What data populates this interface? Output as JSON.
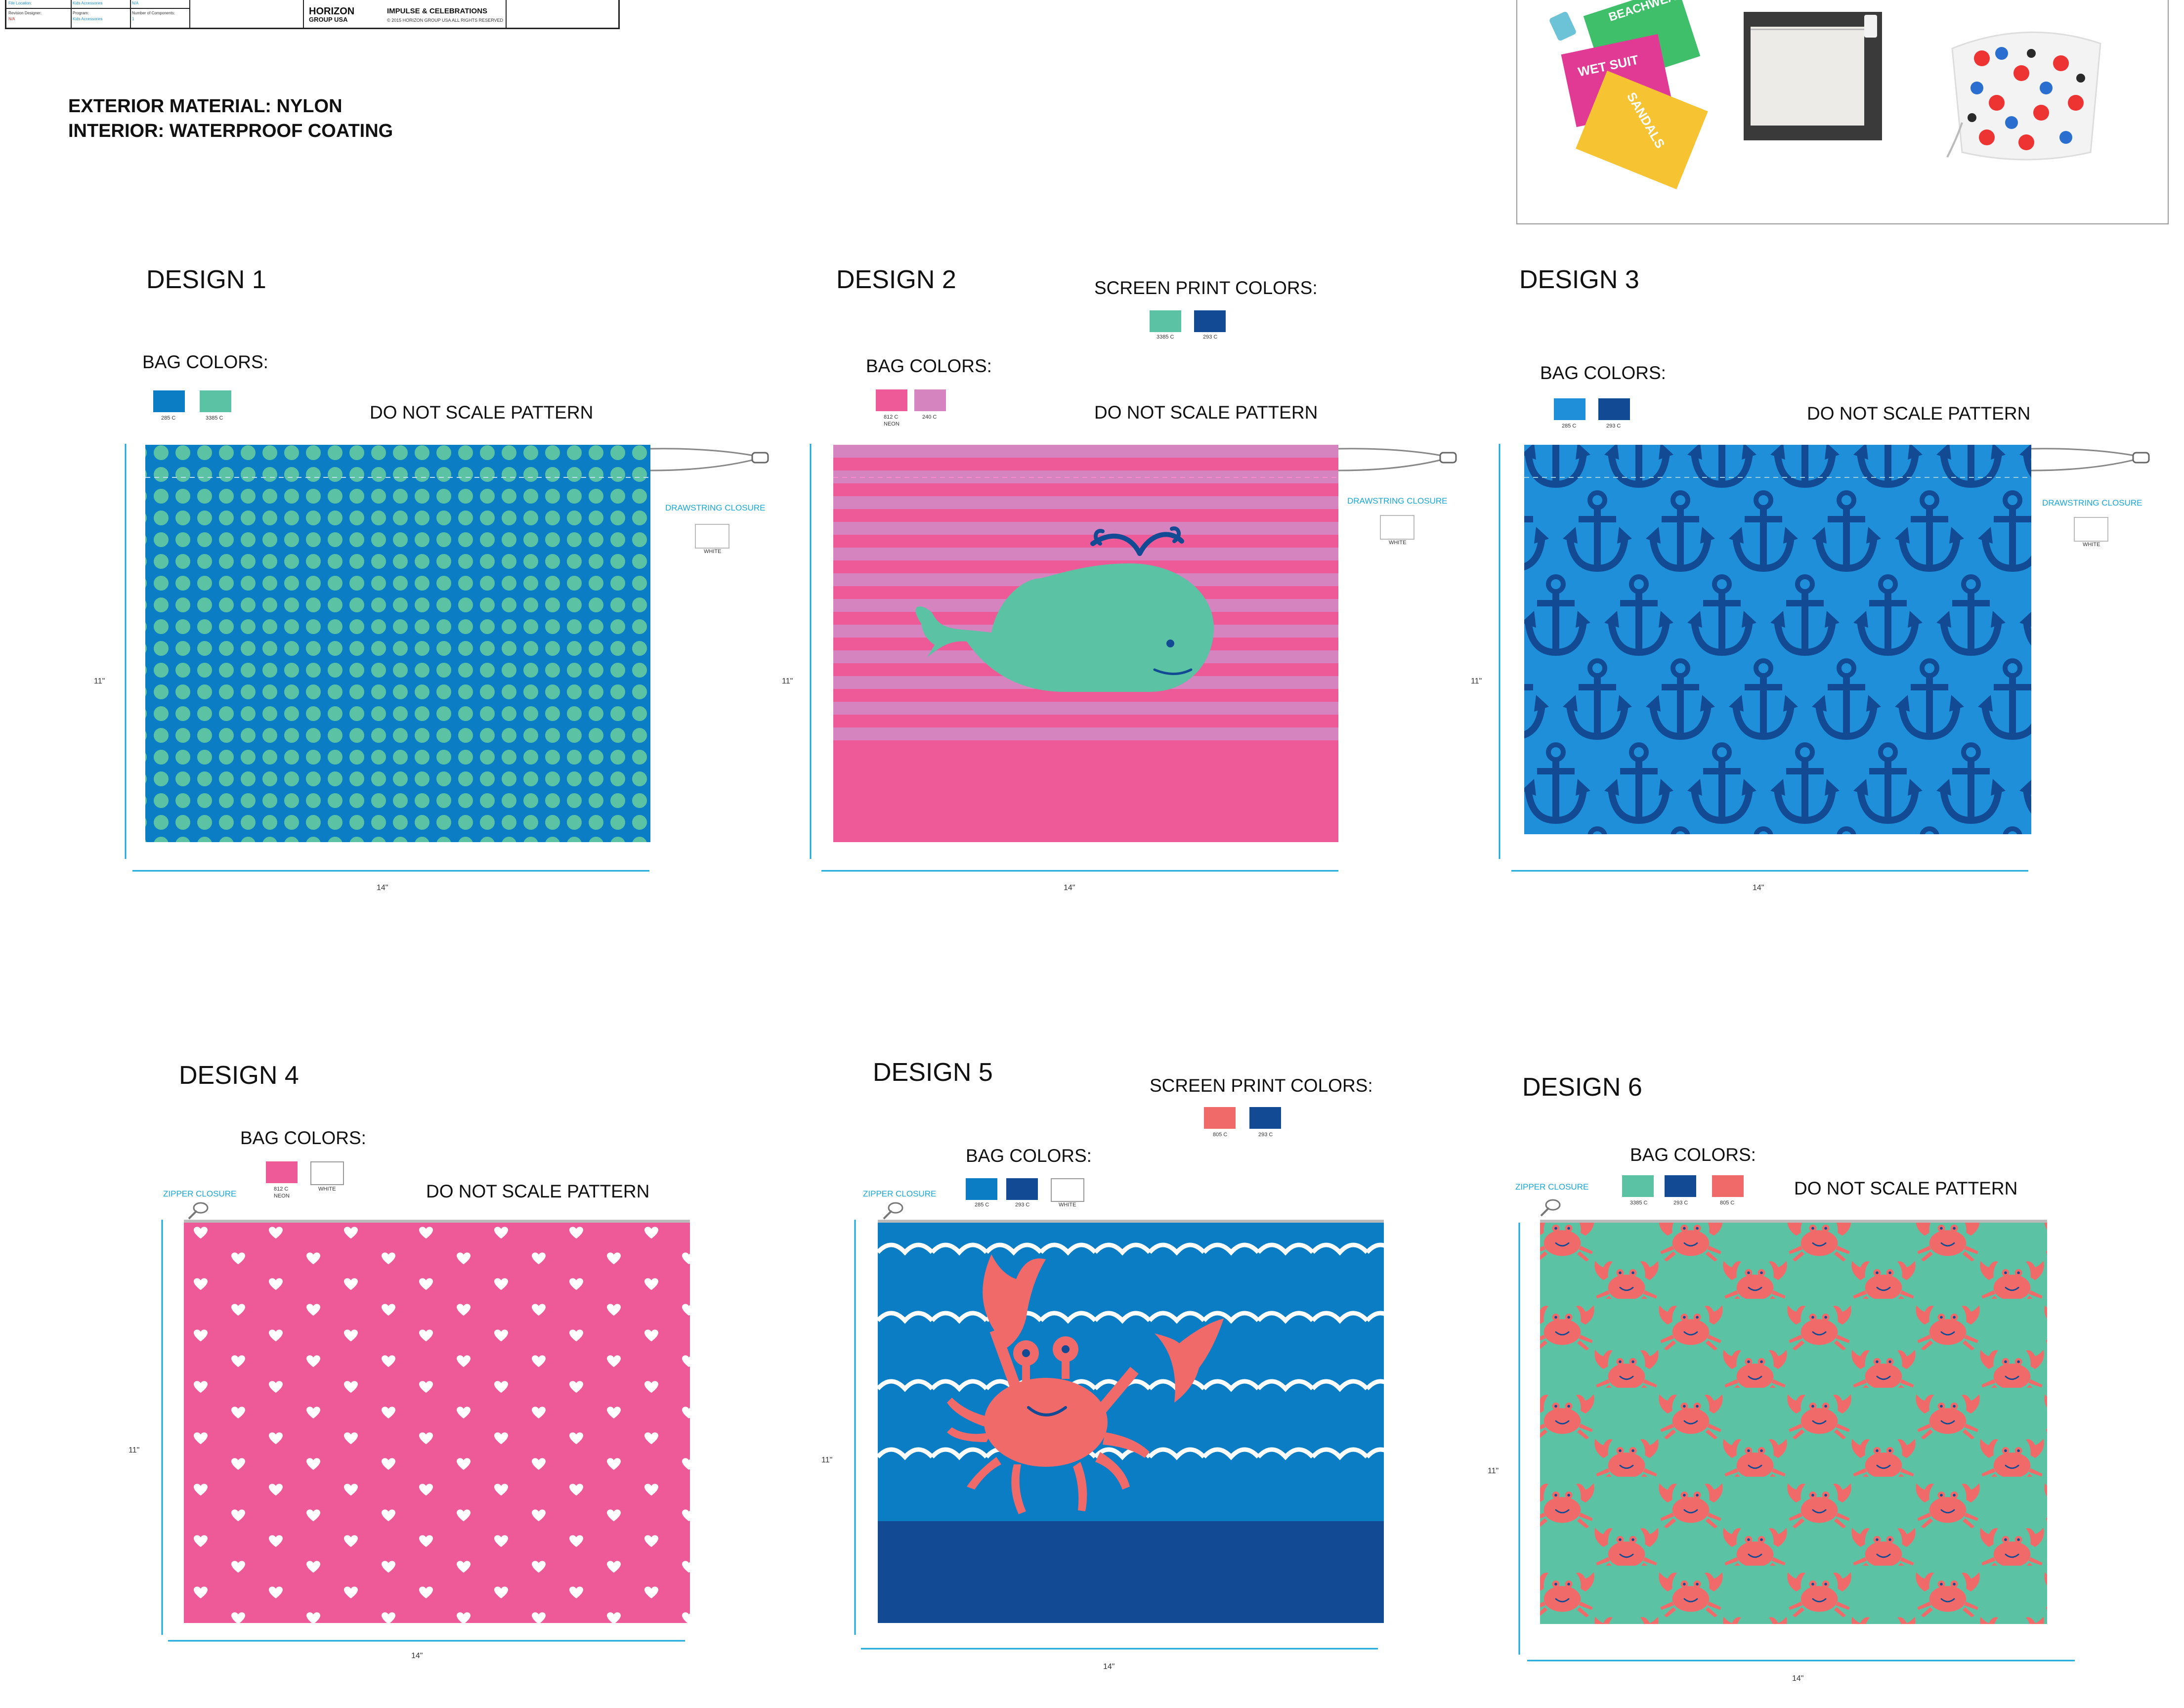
{
  "title_block": {
    "row1": [
      "File Location:",
      "Kids Accessories",
      "N/A"
    ],
    "revision_designer_label": "Revision Designer:",
    "revision_designer_value": "N/A",
    "program_label": "Program:",
    "program_value": "Kids Accessories",
    "components_label": "Number of Components:",
    "components_value": "1",
    "logo_main": "HORIZON",
    "logo_sub": "GROUP USA",
    "brand": "IMPULSE & CELEBRATIONS",
    "copyright": "© 2015 HORIZON GROUP USA ALL RIGHTS RESERVED"
  },
  "materials": {
    "exterior": "EXTERIOR MATERIAL: NYLON",
    "interior": "INTERIOR: WATERPROOF COATING"
  },
  "reference_photo": {
    "bag_labels": [
      "BEACHWEAR",
      "WET SUIT",
      "SANDALS"
    ]
  },
  "common": {
    "do_not_scale": "DO NOT SCALE PATTERN",
    "bag_colors": "BAG COLORS:",
    "screen_print_colors": "SCREEN PRINT COLORS:",
    "drawstring": "DRAWSTRING CLOSURE",
    "zipper": "ZIPPER CLOSURE",
    "string_white": "WHITE",
    "height": "11\"",
    "width": "14\""
  },
  "designs": [
    {
      "title": "DESIGN 1",
      "closure": "drawstring",
      "bag_colors": [
        {
          "hex": "#0a7dc4",
          "code": "285 C"
        },
        {
          "hex": "#5bc3a3",
          "code": "3385 C"
        }
      ]
    },
    {
      "title": "DESIGN 2",
      "closure": "drawstring",
      "bag_colors": [
        {
          "hex": "#ee5a98",
          "code": "812 C",
          "note": "NEON"
        },
        {
          "hex": "#d584c0",
          "code": "240 C"
        }
      ],
      "screen_print_colors": [
        {
          "hex": "#5bc3a3",
          "code": "3385 C"
        },
        {
          "hex": "#124b93",
          "code": "293 C"
        }
      ]
    },
    {
      "title": "DESIGN 3",
      "closure": "drawstring",
      "bag_colors": [
        {
          "hex": "#1e8fd8",
          "code": "285 C"
        },
        {
          "hex": "#124b93",
          "code": "293 C"
        }
      ]
    },
    {
      "title": "DESIGN 4",
      "closure": "zipper",
      "bag_colors": [
        {
          "hex": "#ee5a98",
          "code": "812 C",
          "note": "NEON"
        },
        {
          "hex": "#ffffff",
          "code": "WHITE"
        }
      ]
    },
    {
      "title": "DESIGN 5",
      "closure": "zipper",
      "bag_colors": [
        {
          "hex": "#0a7dc4",
          "code": "285 C"
        },
        {
          "hex": "#124b93",
          "code": "293 C"
        },
        {
          "hex": "#ffffff",
          "code": "WHITE"
        }
      ],
      "screen_print_colors": [
        {
          "hex": "#f06a6a",
          "code": "805 C"
        },
        {
          "hex": "#124b93",
          "code": "293 C"
        }
      ]
    },
    {
      "title": "DESIGN 6",
      "closure": "zipper",
      "bag_colors": [
        {
          "hex": "#5bc3a3",
          "code": "3385 C"
        },
        {
          "hex": "#124b93",
          "code": "293 C"
        },
        {
          "hex": "#f06a6a",
          "code": "805 C"
        }
      ]
    }
  ]
}
